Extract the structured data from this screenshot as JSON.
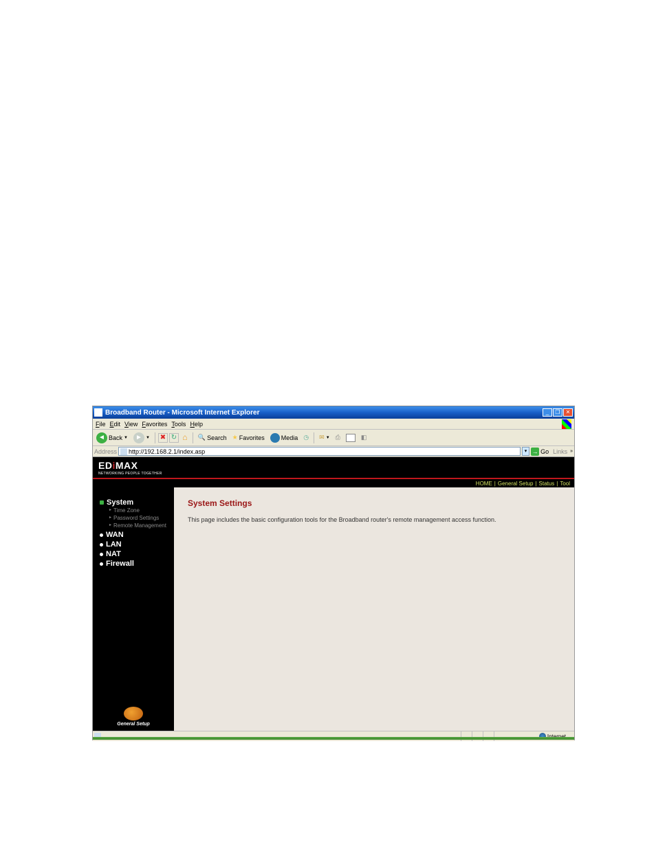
{
  "window": {
    "title": "Broadband Router - Microsoft Internet Explorer"
  },
  "menubar": {
    "file": "File",
    "edit": "Edit",
    "view": "View",
    "favorites": "Favorites",
    "tools": "Tools",
    "help": "Help"
  },
  "toolbar": {
    "back": "Back",
    "search": "Search",
    "favorites": "Favorites",
    "media": "Media"
  },
  "addressbar": {
    "label": "Address",
    "url": "http://192.168.2.1/index.asp",
    "go": "Go",
    "links": "Links"
  },
  "brand": {
    "name_pre": "ED",
    "name_i": "i",
    "name_post": "MAX",
    "tagline": "NETWORKING PEOPLE TOGETHER"
  },
  "topnav": {
    "home": "HOME",
    "general_setup": "General Setup",
    "status": "Status",
    "tool": "Tool"
  },
  "sidebar": {
    "system": "System",
    "children": {
      "time_zone": "Time Zone",
      "password_settings": "Password Settings",
      "remote_management": "Remote Management"
    },
    "wan": "WAN",
    "lan": "LAN",
    "nat": "NAT",
    "firewall": "Firewall",
    "footer": "General Setup"
  },
  "content": {
    "title": "System Settings",
    "description": "This page includes the basic configuration tools for the Broadband router's remote management access function."
  },
  "statusbar": {
    "right": "Internet"
  }
}
